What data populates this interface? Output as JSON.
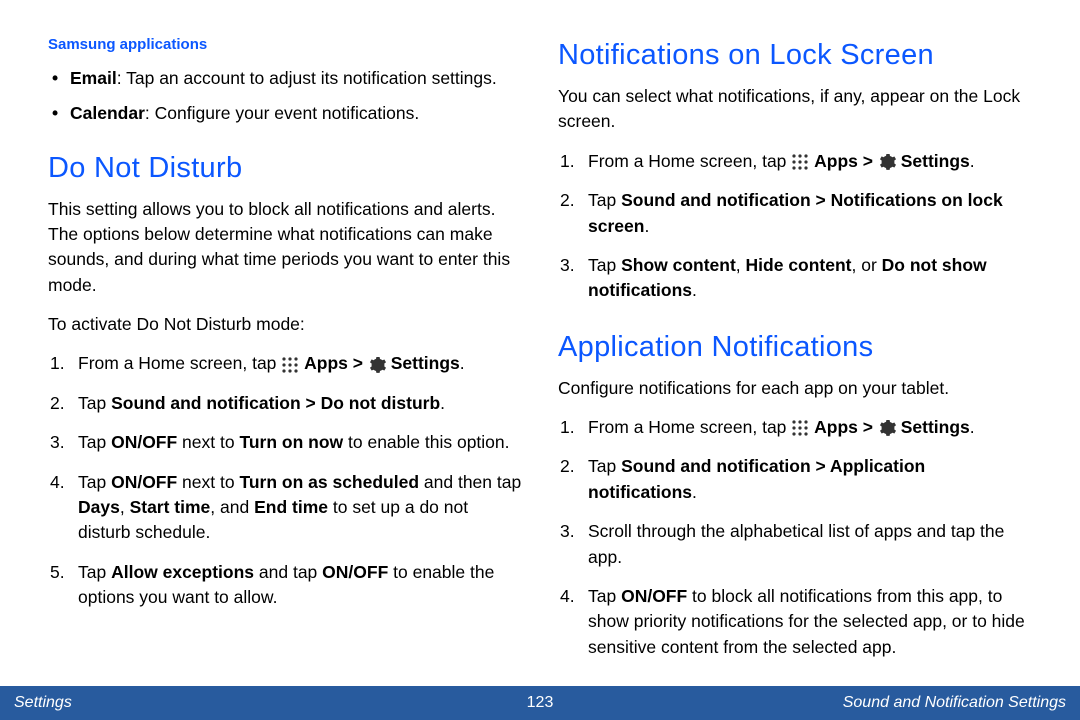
{
  "left": {
    "samsung_title": "Samsung applications",
    "bullets": [
      {
        "label": "Email",
        "text": ": Tap an account to adjust its notification settings."
      },
      {
        "label": "Calendar",
        "text": ": Configure your event notifications."
      }
    ],
    "dnd_title": "Do Not Disturb",
    "dnd_intro": "This setting allows you to block all notifications and alerts. The options below determine what notifications can make sounds, and during what time periods you want to enter this mode.",
    "dnd_activate": "To activate Do Not Disturb mode:",
    "steps": {
      "s1_pre": "From a Home screen, tap ",
      "s1_apps": "Apps > ",
      "s1_settings": "Settings",
      "s1_post": ".",
      "s2_pre": "Tap ",
      "s2_bold": "Sound and notification > Do not disturb",
      "s2_post": ".",
      "s3_pre": "Tap ",
      "s3_b1": "ON/OFF",
      "s3_mid": " next to ",
      "s3_b2": "Turn on now",
      "s3_post": " to enable this option.",
      "s4_pre": "Tap ",
      "s4_b1": "ON/OFF",
      "s4_mid1": " next to ",
      "s4_b2": "Turn on as scheduled",
      "s4_mid2": " and then tap ",
      "s4_b3": "Days",
      "s4_c1": ", ",
      "s4_b4": "Start time",
      "s4_c2": ", and ",
      "s4_b5": "End time",
      "s4_post": " to set up a do not disturb schedule.",
      "s5_pre": "Tap ",
      "s5_b1": "Allow exceptions",
      "s5_mid": " and tap ",
      "s5_b2": "ON/OFF",
      "s5_post": " to enable the options you want to allow."
    }
  },
  "right": {
    "lock_title": "Notifications on Lock Screen",
    "lock_intro": "You can select what notifications, if any, appear on the Lock screen.",
    "lock_steps": {
      "s1_pre": "From a Home screen, tap ",
      "s1_apps": "Apps > ",
      "s1_settings": "Settings",
      "s1_post": ".",
      "s2_pre": "Tap ",
      "s2_bold": "Sound and notification > Notifications on lock screen",
      "s2_post": ".",
      "s3_pre": "Tap ",
      "s3_b1": "Show content",
      "s3_c1": ", ",
      "s3_b2": "Hide content",
      "s3_c2": ", or ",
      "s3_b3": "Do not show notifications",
      "s3_post": "."
    },
    "app_title": "Application Notifications",
    "app_intro": "Configure notifications for each app on your tablet.",
    "app_steps": {
      "s1_pre": "From a Home screen, tap ",
      "s1_apps": "Apps > ",
      "s1_settings": "Settings",
      "s1_post": ".",
      "s2_pre": "Tap ",
      "s2_bold": "Sound and notification > Application notifications",
      "s2_post": ".",
      "s3": "Scroll through the alphabetical list of apps and tap the app.",
      "s4_pre": "Tap ",
      "s4_b1": "ON/OFF",
      "s4_post": " to block all notifications from this app, to show priority notifications for the selected app, or to hide sensitive content from the selected app."
    }
  },
  "footer": {
    "left": "Settings",
    "center": "123",
    "right": "Sound and Notification Settings"
  }
}
